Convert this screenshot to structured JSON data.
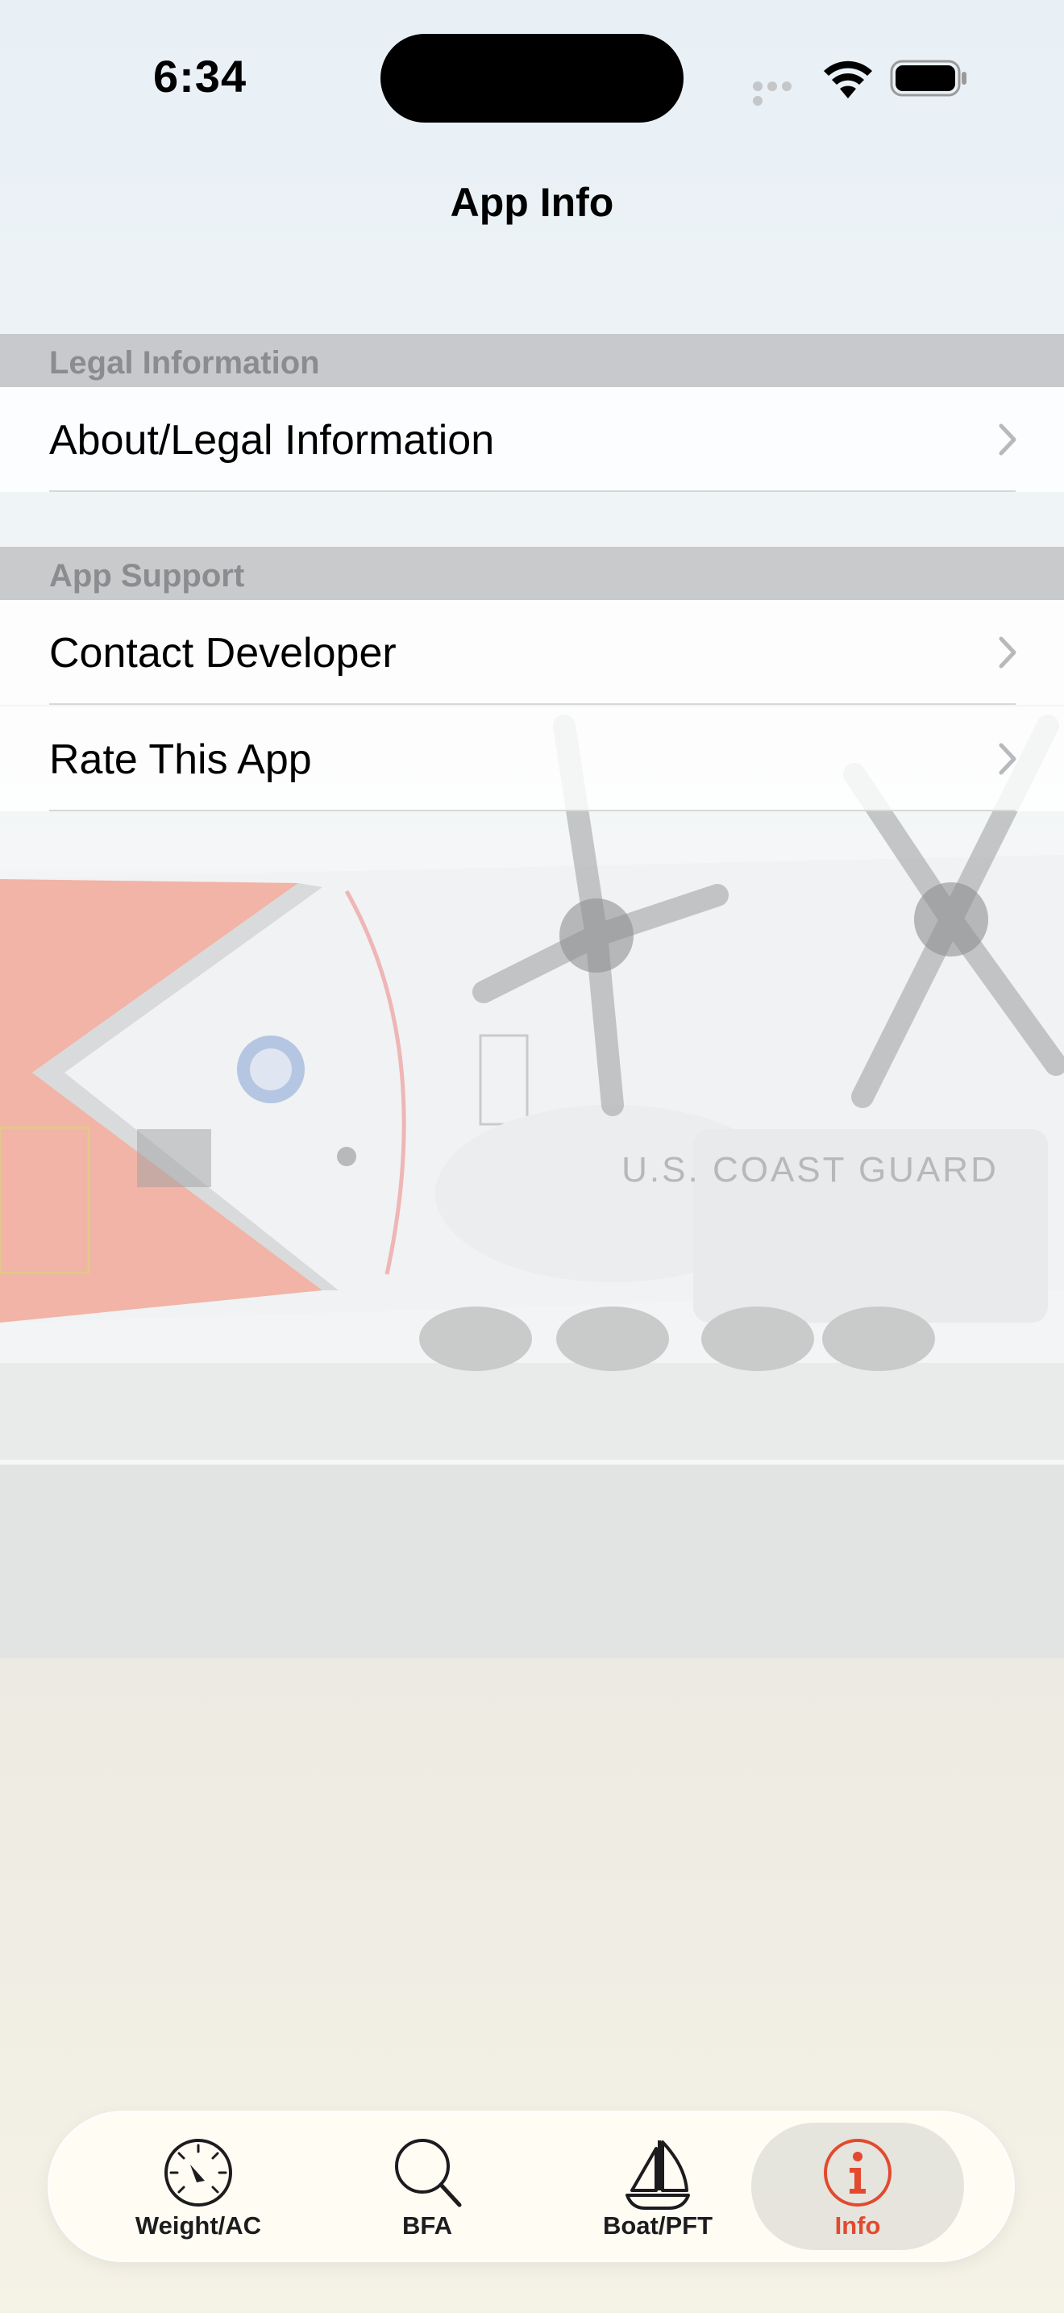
{
  "status_bar": {
    "time": "6:34"
  },
  "nav": {
    "title": "App Info"
  },
  "sections": [
    {
      "header": "Legal Information",
      "rows": [
        {
          "label": "About/Legal Information"
        }
      ]
    },
    {
      "header": "App Support",
      "rows": [
        {
          "label": "Contact Developer"
        },
        {
          "label": "Rate This App"
        }
      ]
    }
  ],
  "background_text": "U.S. COAST GUARD",
  "tabs": [
    {
      "label": "Weight/AC",
      "icon": "gauge-icon",
      "selected": false
    },
    {
      "label": "BFA",
      "icon": "magnifier-icon",
      "selected": false
    },
    {
      "label": "Boat/PFT",
      "icon": "sailboat-icon",
      "selected": false
    },
    {
      "label": "Info",
      "icon": "info-icon",
      "selected": true
    }
  ],
  "colors": {
    "accent": "#e2492f",
    "section_header": "#c4c6c8",
    "tab_bar": "#fffdf4"
  }
}
